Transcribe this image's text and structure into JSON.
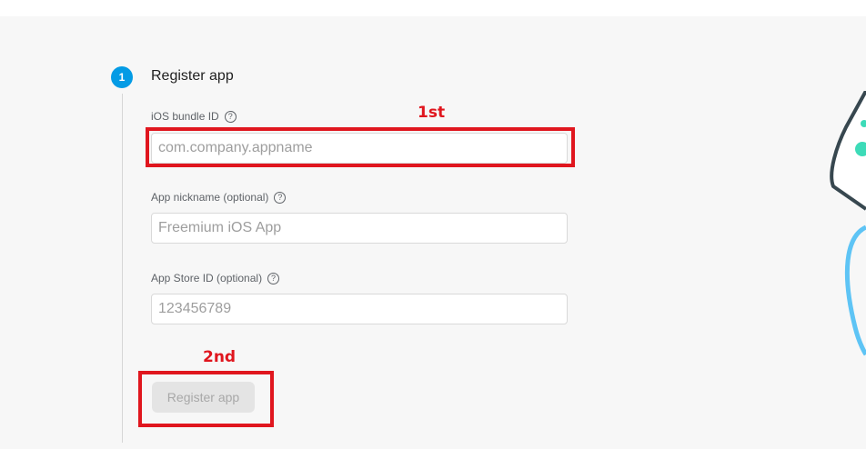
{
  "step": {
    "number": "1",
    "title": "Register app"
  },
  "fields": {
    "bundle_id": {
      "label": "iOS bundle ID",
      "placeholder": "com.company.appname"
    },
    "nickname": {
      "label": "App nickname (optional)",
      "placeholder": "Freemium iOS App"
    },
    "store_id": {
      "label": "App Store ID (optional)",
      "placeholder": "123456789"
    }
  },
  "help_icon": "help-circle-icon",
  "help_glyph": "?",
  "register_button_label": "Register app",
  "annotations": {
    "first_label": "1st",
    "second_label": "2nd",
    "color": "#e0161e"
  },
  "colors": {
    "step_accent": "#039be5",
    "illustration_phone": "#37474f",
    "illustration_teal": "#3ddbb8",
    "illustration_curve": "#5ec4f5"
  }
}
